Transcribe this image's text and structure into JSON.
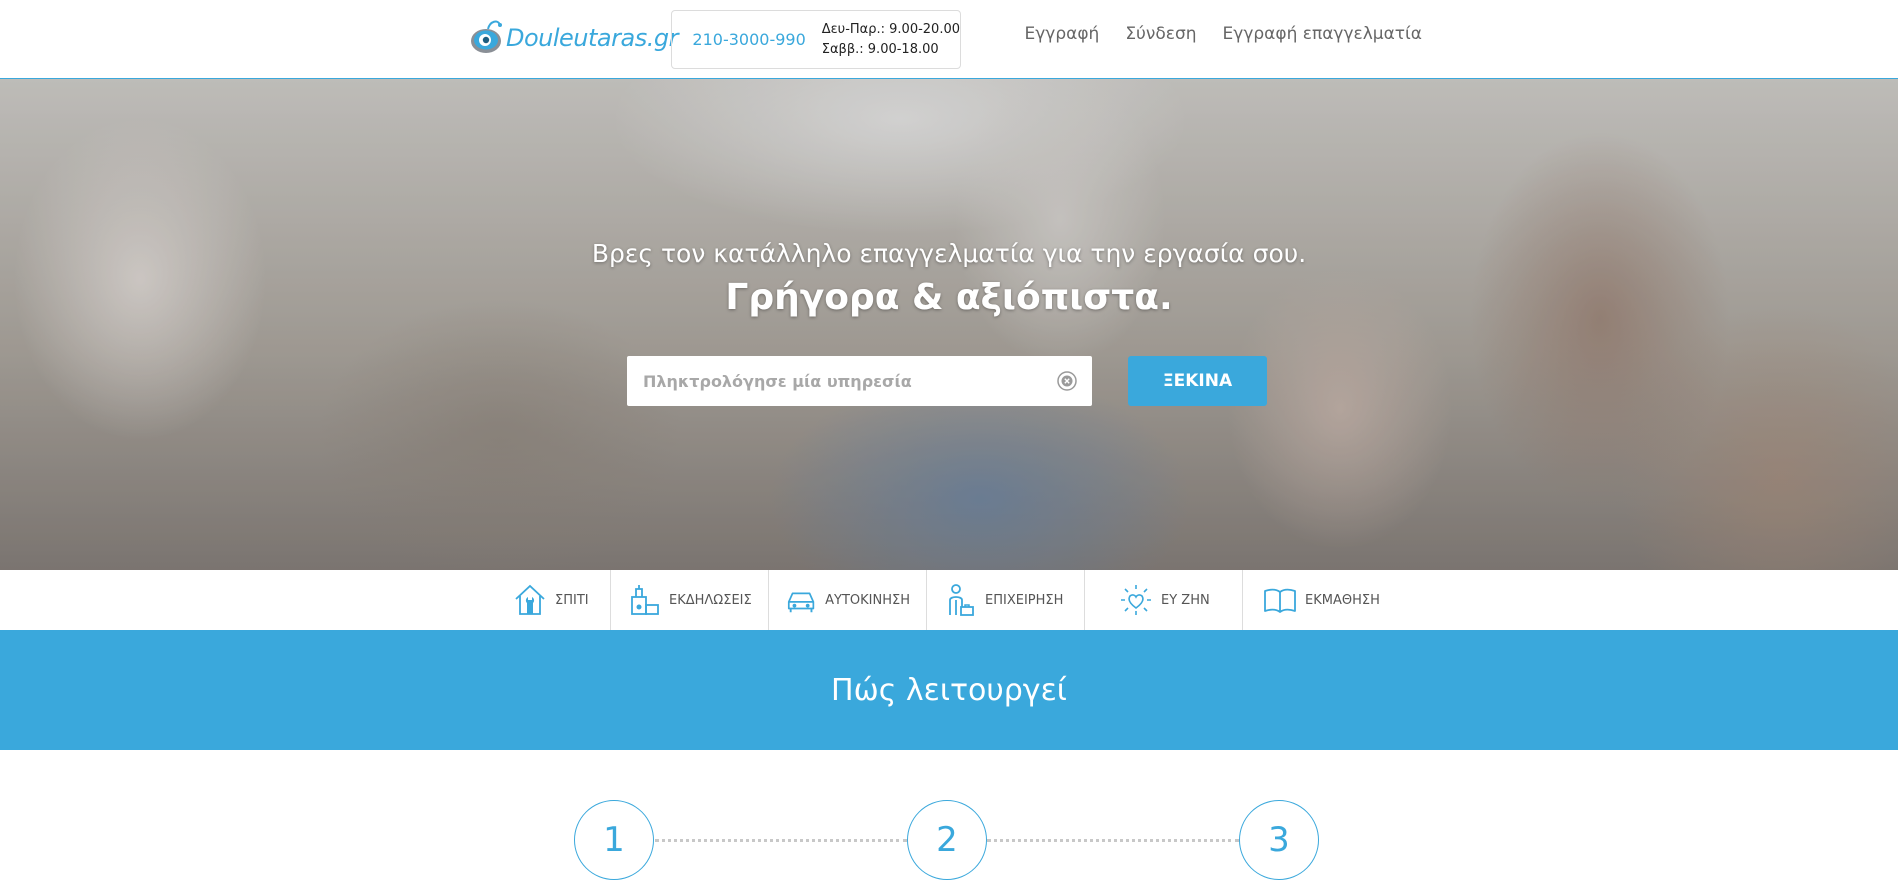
{
  "header": {
    "logo_text": "Douleutaras.gr",
    "phone": "210-3000-990",
    "hours_weekdays": "Δευ-Παρ.: 9.00-20.00",
    "hours_saturday": "Σαββ.: 9.00-18.00",
    "nav": {
      "register": "Εγγραφή",
      "login": "Σύνδεση",
      "register_pro": "Εγγραφή επαγγελματία"
    }
  },
  "hero": {
    "subtitle": "Βρες τον κατάλληλο επαγγελματία για την εργασία σου.",
    "title": "Γρήγορα & αξιόπιστα.",
    "search_placeholder": "Πληκτρολόγησε μία υπηρεσία",
    "search_value": "",
    "start_button": "ΞΕΚΙΝΑ"
  },
  "categories": [
    {
      "label": "ΣΠΙΤΙ",
      "icon": "house-icon"
    },
    {
      "label": "ΕΚΔΗΛΩΣΕΙΣ",
      "icon": "events-icon"
    },
    {
      "label": "ΑΥΤΟΚΙΝΗΣΗ",
      "icon": "car-icon"
    },
    {
      "label": "ΕΠΙΧΕΙΡΗΣΗ",
      "icon": "business-icon"
    },
    {
      "label": "ΕΥ ΖΗΝ",
      "icon": "heart-sun-icon"
    },
    {
      "label": "ΕΚΜΑΘΗΣΗ",
      "icon": "book-icon"
    }
  ],
  "how_it_works": {
    "title": "Πώς λειτουργεί",
    "steps": [
      "1",
      "2",
      "3"
    ]
  },
  "colors": {
    "accent": "#3aa8dc",
    "text_muted": "#666666"
  }
}
